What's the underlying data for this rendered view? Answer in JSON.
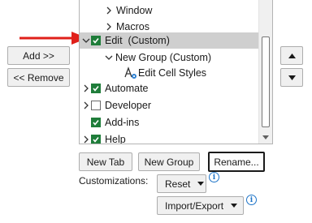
{
  "left_buttons": {
    "add": "Add >>",
    "remove": "<< Remove"
  },
  "tree": {
    "rows": [
      {
        "label": "Window",
        "expander": "collapsed",
        "checkbox": null
      },
      {
        "label": "Macros",
        "expander": "collapsed",
        "checkbox": null
      },
      {
        "label": "Edit  (Custom)",
        "expander": "expanded",
        "checkbox": true,
        "selected": true
      },
      {
        "label": "New Group (Custom)",
        "expander": "expanded",
        "checkbox": null
      },
      {
        "label": "Edit Cell Styles",
        "expander": null,
        "checkbox": null,
        "icon": "edit-styles-icon"
      },
      {
        "label": "Automate",
        "expander": "collapsed",
        "checkbox": true
      },
      {
        "label": "Developer",
        "expander": "collapsed",
        "checkbox": false
      },
      {
        "label": "Add-ins",
        "expander": null,
        "checkbox": true
      },
      {
        "label": "Help",
        "expander": "collapsed",
        "checkbox": true
      }
    ]
  },
  "tree_buttons": {
    "new_tab": "New Tab",
    "new_group": "New Group",
    "rename": "Rename..."
  },
  "customizations": {
    "label": "Customizations:",
    "reset": "Reset",
    "import_export": "Import/Export"
  },
  "icons": {
    "annotation": "red-arrow-icon",
    "move_up": "triangle-up-icon",
    "move_down": "triangle-down-icon",
    "info": "info-icon"
  },
  "colors": {
    "checkbox_checked": "#1f7d3a",
    "selection": "#cfcfcf",
    "arrow": "#e0201a",
    "info": "#1e74c8"
  }
}
